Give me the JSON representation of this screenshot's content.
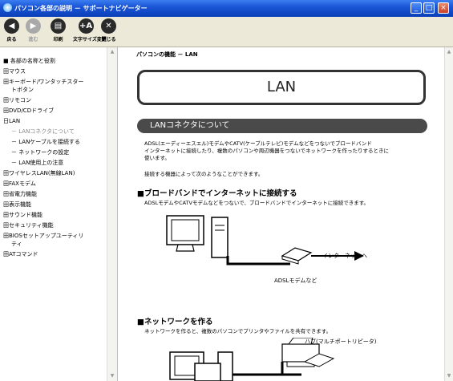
{
  "window": {
    "title": "パソコン各部の説明 － サポートナビゲーター",
    "buttons": [
      "_",
      "□",
      "×"
    ]
  },
  "toolbar": {
    "buttons": [
      {
        "label": "戻る",
        "icon": "◀"
      },
      {
        "label": "進む",
        "icon": "▶"
      },
      {
        "label": "印刷",
        "icon": "▤"
      },
      {
        "label": "文字サイズ変更",
        "icon": "+A"
      },
      {
        "label": "閉じる",
        "icon": "✕"
      }
    ]
  },
  "sidebar": {
    "items": [
      {
        "label": "■ 各部の名称と役割"
      },
      {
        "label": "田マウス"
      },
      {
        "label": "田キーボード/ワンタッチスター"
      },
      {
        "label": "トボタン"
      },
      {
        "label": "田リモコン"
      },
      {
        "label": "田DVD/CDドライブ"
      },
      {
        "label": "日LAN"
      },
      {
        "label": "－ LANコネクタについて"
      },
      {
        "label": "－ LANケーブルを接続する"
      },
      {
        "label": "－ ネットワークの設定"
      },
      {
        "label": "－ LAN使用上の注意"
      },
      {
        "label": "田ワイヤレスLAN(無線LAN)"
      },
      {
        "label": "田FAXモデム"
      },
      {
        "label": "田省電力機能"
      },
      {
        "label": "田表示機能"
      },
      {
        "label": "田サウンド機能"
      },
      {
        "label": "田セキュリティ機能"
      },
      {
        "label": "田BIOSセットアップユーティリ"
      },
      {
        "label": "ティ"
      },
      {
        "label": "田ATコマンド"
      }
    ]
  },
  "content": {
    "breadcrumb": "パソコンの機能 － LAN",
    "title": "LAN",
    "section_title": "LANコネクタについて",
    "intro_lines": [
      "ADSL(エーディーエスエル)モデムやCATV(ケーブルテレビ)モデムなどをつないでブロードバンド",
      "インターネットに接続したり、複数のパソコンや周辺機器をつないでネットワークを作ったりするときに",
      "使います。"
    ],
    "connect_note": "接続する機器によって次のようなことができます。",
    "broadband": {
      "heading": "■ブロードバンドでインターネットに接続する",
      "text": "ADSLモデムやCATVモデムなどをつないで、ブロードバンドでインターネットに接続できます。",
      "modem_label": "ADSLモデムなど",
      "internet_label": "インターネットへ"
    },
    "network": {
      "heading": "■ネットワークを作る",
      "text": "ネットワークを作ると、複数のパソコンでプリンタやファイルを共有できます。",
      "hub_label": "ハブ(マルチポートリピータ)"
    }
  }
}
